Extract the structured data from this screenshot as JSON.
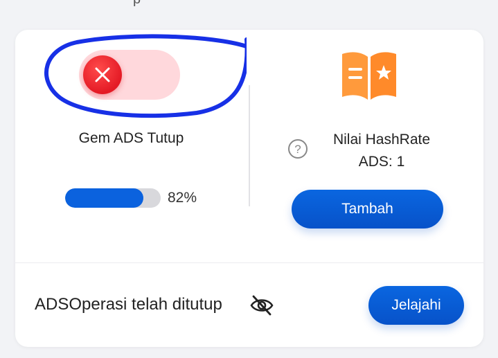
{
  "header": {
    "partial_text": "p",
    "icon": "megaphone-icon"
  },
  "ads_toggle": {
    "state": "off",
    "icon": "close-icon",
    "label": "Gem ADS Tutup"
  },
  "progress": {
    "value": 0.82,
    "label": "82%"
  },
  "hashrate": {
    "icon": "book-icon",
    "help_icon": "question-icon",
    "line1": "Nilai HashRate",
    "line2": "ADS: 1",
    "button_label": "Tambah"
  },
  "footer": {
    "status": "ADSOperasi telah ditutup",
    "eye_icon": "eye-off-icon",
    "button_label": "Jelajahi"
  },
  "colors": {
    "accent_blue": "#0b62de",
    "toggle_off_bg": "#ffd8dc",
    "toggle_knob": "#e41a25",
    "book_orange": "#ff8a2a",
    "annotation_blue": "#1730e6"
  }
}
